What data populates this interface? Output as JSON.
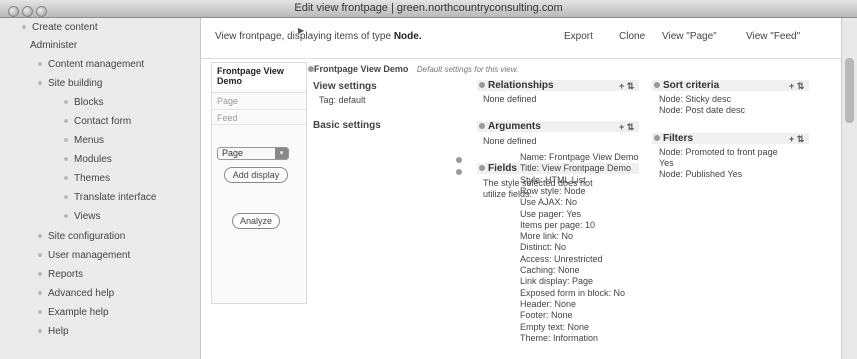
{
  "window": {
    "title": "Edit view frontpage | green.northcountryconsulting.com"
  },
  "sidebar": {
    "items": [
      {
        "label": "Create content"
      },
      {
        "label": "Administer"
      },
      {
        "label": "Content management"
      },
      {
        "label": "Site building"
      },
      {
        "label": "Blocks"
      },
      {
        "label": "Contact form"
      },
      {
        "label": "Menus"
      },
      {
        "label": "Modules"
      },
      {
        "label": "Themes"
      },
      {
        "label": "Translate interface"
      },
      {
        "label": "Views"
      },
      {
        "label": "Site configuration"
      },
      {
        "label": "User management"
      },
      {
        "label": "Reports"
      },
      {
        "label": "Advanced help"
      },
      {
        "label": "Example help"
      },
      {
        "label": "Help"
      }
    ]
  },
  "topbar": {
    "desc_prefix": "View frontpage, displaying items of type",
    "desc_type": "Node.",
    "export": "Export",
    "clone": "Clone",
    "view_page": "View \"Page\"",
    "view_feed": "View \"Feed\""
  },
  "displays": {
    "active": "Frontpage View Demo",
    "tabs": [
      "Page",
      "Feed"
    ],
    "select_value": "Page",
    "add_display": "Add display",
    "analyze": "Analyze"
  },
  "header": {
    "title": "Frontpage View Demo",
    "note": "Default settings for this view."
  },
  "view_settings": {
    "title": "View settings",
    "tag": "Tag: default"
  },
  "basic_settings": {
    "title": "Basic settings",
    "lines": [
      "Name: Frontpage View Demo",
      "Title: View Frontpage Demo",
      "Style: HTML List",
      "Row style: Node",
      "Use AJAX: No",
      "Use pager: Yes",
      "Items per page: 10",
      "More link: No",
      "Distinct: No",
      "Access: Unrestricted",
      "Caching: None",
      "Link display: Page",
      "Exposed form in block: No",
      "Header: None",
      "Footer: None",
      "Empty text: None",
      "Theme: Information"
    ]
  },
  "relationships": {
    "title": "Relationships",
    "empty": "None defined",
    "ops": "+ ⇅"
  },
  "arguments": {
    "title": "Arguments",
    "empty": "None defined",
    "ops": "+ ⇅"
  },
  "fields": {
    "title": "Fields",
    "note1": "The style selected does not",
    "note2": "utilize fields."
  },
  "sort_criteria": {
    "title": "Sort criteria",
    "ops": "+ ⇅",
    "items": [
      "Node: Sticky desc",
      "Node: Post date desc"
    ]
  },
  "filters": {
    "title": "Filters",
    "ops": "+ ⇅",
    "items": [
      "Node: Promoted to front page",
      "Yes",
      "Node: Published Yes"
    ]
  }
}
